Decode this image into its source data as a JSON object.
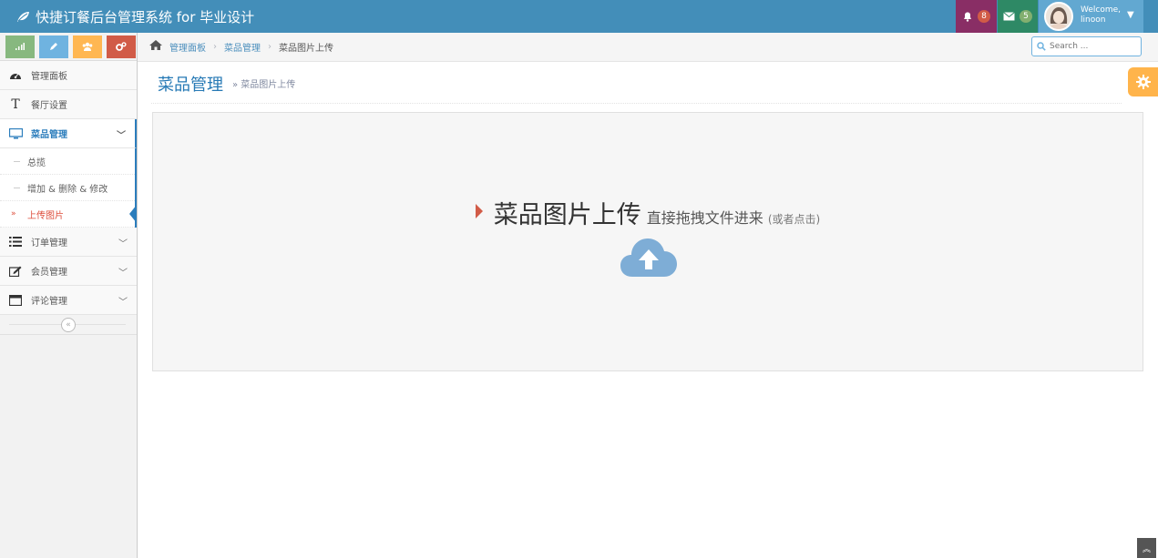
{
  "app": {
    "title": "快捷订餐后台管理系统 for 毕业设计"
  },
  "navbar": {
    "notifications": {
      "icon": "bell-icon",
      "count": "8",
      "color": "#892e65"
    },
    "messages": {
      "icon": "envelope-icon",
      "count": "5",
      "color": "#2e8965"
    },
    "user": {
      "welcome": "Welcome,",
      "name": "linoon"
    }
  },
  "sidebar": {
    "shortcuts": [
      {
        "icon": "signal-icon",
        "color": "#87b87f"
      },
      {
        "icon": "pencil-icon",
        "color": "#6fb3e0"
      },
      {
        "icon": "group-icon",
        "color": "#ffb752"
      },
      {
        "icon": "cogs-icon",
        "color": "#d15b47"
      }
    ],
    "items": [
      {
        "label": "管理面板",
        "icon": "dashboard-icon"
      },
      {
        "label": "餐厅设置",
        "icon": "text-icon"
      },
      {
        "label": "菜品管理",
        "icon": "desktop-icon",
        "active": true,
        "sub": [
          {
            "label": "总揽"
          },
          {
            "label": "增加 & 删除 & 修改"
          },
          {
            "label": "上传图片",
            "current": true
          }
        ]
      },
      {
        "label": "订单管理",
        "icon": "list-icon"
      },
      {
        "label": "会员管理",
        "icon": "edit-icon"
      },
      {
        "label": "评论管理",
        "icon": "calendar-icon"
      }
    ],
    "collapse_symbol": "«"
  },
  "breadcrumb": {
    "home": "管理面板",
    "section": "菜品管理",
    "current": "菜品图片上传"
  },
  "search": {
    "placeholder": "Search ..."
  },
  "page": {
    "title": "菜品管理",
    "subtitle": "» 菜品图片上传"
  },
  "dropzone": {
    "title": "菜品图片上传",
    "hint": "直接拖拽文件进来",
    "alt": "(或者点击)"
  },
  "accent": {
    "primary": "#438eb9",
    "link": "#2679b5",
    "danger": "#d15b47",
    "warning": "#ffb44b"
  }
}
